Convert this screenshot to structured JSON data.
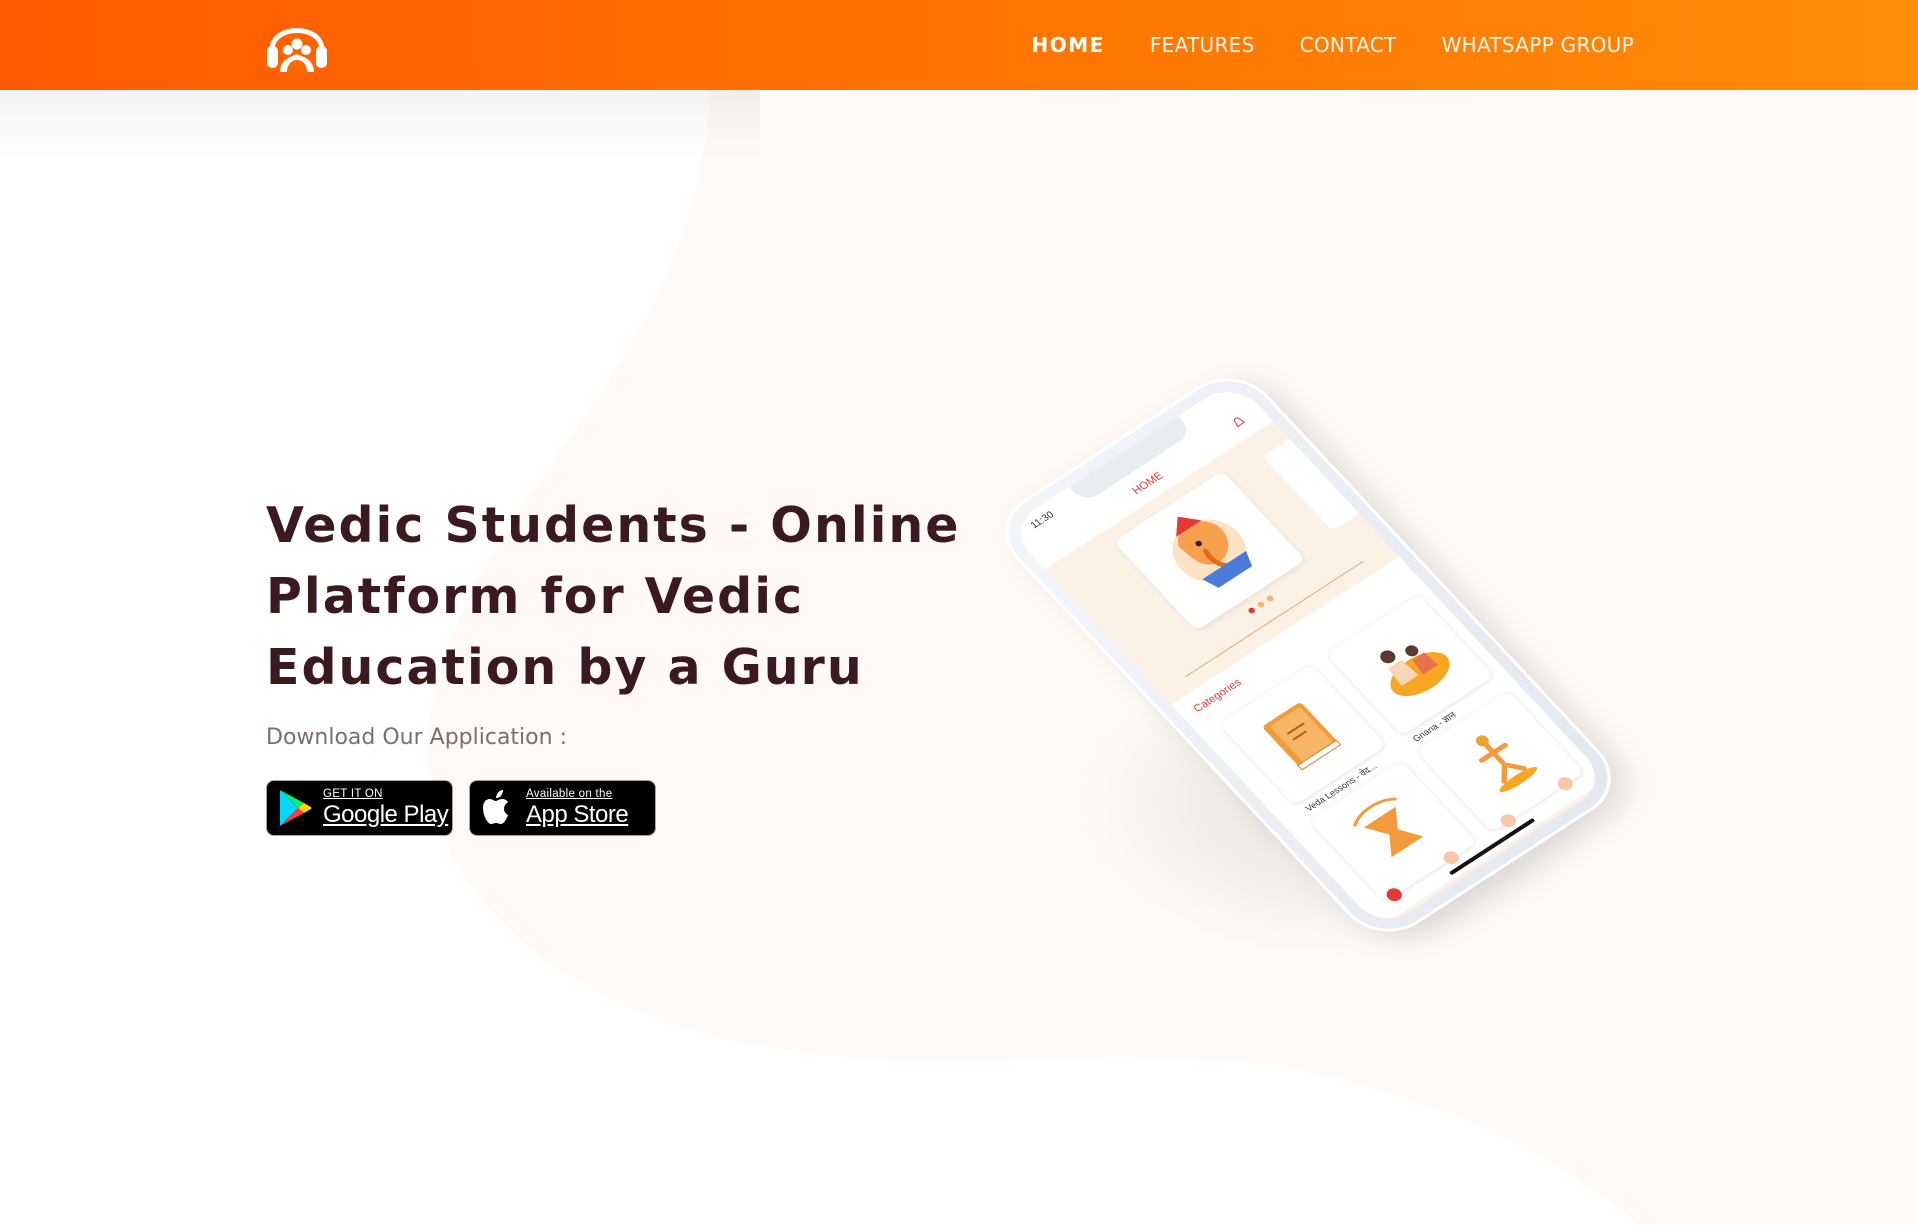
{
  "brand": {
    "logo": "headphones-people-logo",
    "colors": {
      "navbar_start": "#ff5a00",
      "navbar_end": "#ff8c0a",
      "title": "#3b1a1f",
      "hero_blob": "#fffaf5"
    }
  },
  "nav": {
    "items": [
      {
        "label": "HOME",
        "active": true
      },
      {
        "label": "FEATURES",
        "active": false
      },
      {
        "label": "CONTACT",
        "active": false
      },
      {
        "label": "WHATSAPP GROUP",
        "active": false
      }
    ]
  },
  "hero": {
    "title_lines": [
      "Vedic Students - Online",
      "Platform for Vedic",
      "Education by a Guru"
    ],
    "subtitle": "Download Our Application :",
    "badges": {
      "google_play": {
        "small": "GET IT ON",
        "big": "Google Play",
        "icon": "google-play-icon"
      },
      "app_store": {
        "small": "Available on the",
        "big": "App Store",
        "icon": "apple-icon"
      }
    }
  },
  "phone_screen": {
    "time": "11:30",
    "header_title": "HOME",
    "categories_label": "Categories",
    "cards": [
      "Veda Lessons - वेद...",
      "Gnana - ज्ञान"
    ]
  }
}
